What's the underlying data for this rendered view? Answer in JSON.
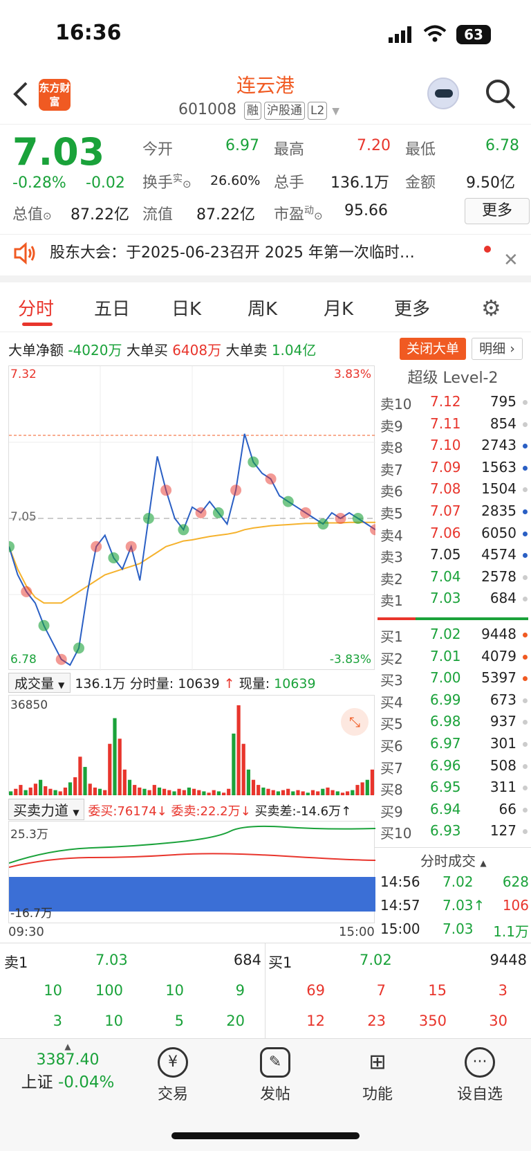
{
  "status": {
    "time": "16:36",
    "battery": "63"
  },
  "header": {
    "logo": "东方财富",
    "title": "连云港",
    "code": "601008",
    "tags": [
      "融",
      "沪股通",
      "L2"
    ]
  },
  "quote": {
    "price": "7.03",
    "change_pct": "-0.28%",
    "change": "-0.02",
    "open_label": "今开",
    "open": "6.97",
    "high_label": "最高",
    "high": "7.20",
    "low_label": "最低",
    "low": "6.78",
    "turnover_label": "换手",
    "turnover_sup": "实",
    "turnover": "26.60%",
    "volume_label": "总手",
    "volume": "136.1万",
    "amount_label": "金额",
    "amount": "9.50亿",
    "mktcap_label": "总值",
    "mktcap": "87.22亿",
    "float_label": "流值",
    "float": "87.22亿",
    "pe_label": "市盈",
    "pe_sup": "动",
    "pe": "95.66",
    "more": "更多"
  },
  "notice": {
    "text": "股东大会：于2025-06-23召开 2025 年第一次临时…"
  },
  "tabs": [
    "分时",
    "五日",
    "日K",
    "周K",
    "月K",
    "更多"
  ],
  "bigorder": {
    "net_label": "大单净额",
    "net": "-4020万",
    "buy_label": "大单买",
    "buy": "6408万",
    "sell_label": "大单卖",
    "sell": "1.04亿",
    "close_btn": "关闭大单",
    "detail_btn": "明细"
  },
  "chart_data": {
    "type": "line",
    "ylim": [
      6.78,
      7.32
    ],
    "pct_range": [
      "3.83%",
      "-3.83%"
    ],
    "y_top": "7.32",
    "y_bottom": "6.78",
    "y_mid": "7.05",
    "price": [
      7.0,
      6.95,
      6.92,
      6.9,
      6.86,
      6.83,
      6.8,
      6.79,
      6.82,
      6.92,
      7.0,
      7.02,
      6.98,
      6.96,
      7.0,
      6.94,
      7.05,
      7.16,
      7.1,
      7.05,
      7.03,
      7.07,
      7.06,
      7.08,
      7.06,
      7.04,
      7.1,
      7.2,
      7.15,
      7.13,
      7.12,
      7.09,
      7.08,
      7.07,
      7.06,
      7.05,
      7.04,
      7.06,
      7.05,
      7.06,
      7.05,
      7.04,
      7.03
    ],
    "avg": [
      7.0,
      6.96,
      6.93,
      6.91,
      6.9,
      6.9,
      6.9,
      6.91,
      6.92,
      6.93,
      6.94,
      6.95,
      6.955,
      6.96,
      6.965,
      6.97,
      6.98,
      6.99,
      7.0,
      7.005,
      7.01,
      7.012,
      7.015,
      7.018,
      7.02,
      7.022,
      7.025,
      7.03,
      7.033,
      7.035,
      7.037,
      7.038,
      7.039,
      7.04,
      7.041,
      7.041,
      7.042,
      7.042,
      7.042,
      7.043,
      7.043,
      7.043,
      7.043
    ],
    "volume_max": "36850",
    "x_start": "09:30",
    "x_end": "15:00"
  },
  "volume_bar": {
    "label": "成交量",
    "total": "136.1万",
    "tick_label": "分时量:",
    "tick": "10639",
    "now_label": "现量:",
    "now": "10639"
  },
  "force": {
    "label": "买卖力道",
    "bid": "委买:76174",
    "ask": "委卖:22.2万",
    "diff": "买卖差:-14.6万",
    "top": "25.3万",
    "bottom": "-16.7万"
  },
  "orderbook": {
    "title": "超级 Level-2",
    "asks": [
      {
        "label": "卖10",
        "price": "7.12",
        "vol": "795"
      },
      {
        "label": "卖9",
        "price": "7.11",
        "vol": "854"
      },
      {
        "label": "卖8",
        "price": "7.10",
        "vol": "2743"
      },
      {
        "label": "卖7",
        "price": "7.09",
        "vol": "1563"
      },
      {
        "label": "卖6",
        "price": "7.08",
        "vol": "1504"
      },
      {
        "label": "卖5",
        "price": "7.07",
        "vol": "2835"
      },
      {
        "label": "卖4",
        "price": "7.06",
        "vol": "6050"
      },
      {
        "label": "卖3",
        "price": "7.05",
        "vol": "4574"
      },
      {
        "label": "卖2",
        "price": "7.04",
        "vol": "2578"
      },
      {
        "label": "卖1",
        "price": "7.03",
        "vol": "684"
      }
    ],
    "bids": [
      {
        "label": "买1",
        "price": "7.02",
        "vol": "9448"
      },
      {
        "label": "买2",
        "price": "7.01",
        "vol": "4079"
      },
      {
        "label": "买3",
        "price": "7.00",
        "vol": "5397"
      },
      {
        "label": "买4",
        "price": "6.99",
        "vol": "673"
      },
      {
        "label": "买5",
        "price": "6.98",
        "vol": "937"
      },
      {
        "label": "买6",
        "price": "6.97",
        "vol": "301"
      },
      {
        "label": "买7",
        "price": "6.96",
        "vol": "508"
      },
      {
        "label": "买8",
        "price": "6.95",
        "vol": "311"
      },
      {
        "label": "买9",
        "price": "6.94",
        "vol": "66"
      },
      {
        "label": "买10",
        "price": "6.93",
        "vol": "127"
      }
    ],
    "trades_title": "分时成交",
    "trades": [
      {
        "time": "14:56",
        "price": "7.02",
        "vol": "628"
      },
      {
        "time": "14:57",
        "price": "7.03↑",
        "vol": "106"
      },
      {
        "time": "15:00",
        "price": "7.03",
        "vol": "1.1万"
      }
    ]
  },
  "queue": {
    "sell_label": "卖1",
    "sell_price": "7.03",
    "sell_vol": "684",
    "buy_label": "买1",
    "buy_price": "7.02",
    "buy_vol": "9448",
    "sell_rows": [
      [
        "10",
        "100",
        "10",
        "9"
      ],
      [
        "3",
        "10",
        "5",
        "20"
      ]
    ],
    "buy_rows": [
      [
        "69",
        "7",
        "15",
        "3"
      ],
      [
        "12",
        "23",
        "350",
        "30"
      ]
    ]
  },
  "bottom": {
    "index_value": "3387.40",
    "index_name": "上证",
    "index_change": "-0.04%",
    "nav": [
      "交易",
      "发帖",
      "功能",
      "设自选"
    ]
  }
}
